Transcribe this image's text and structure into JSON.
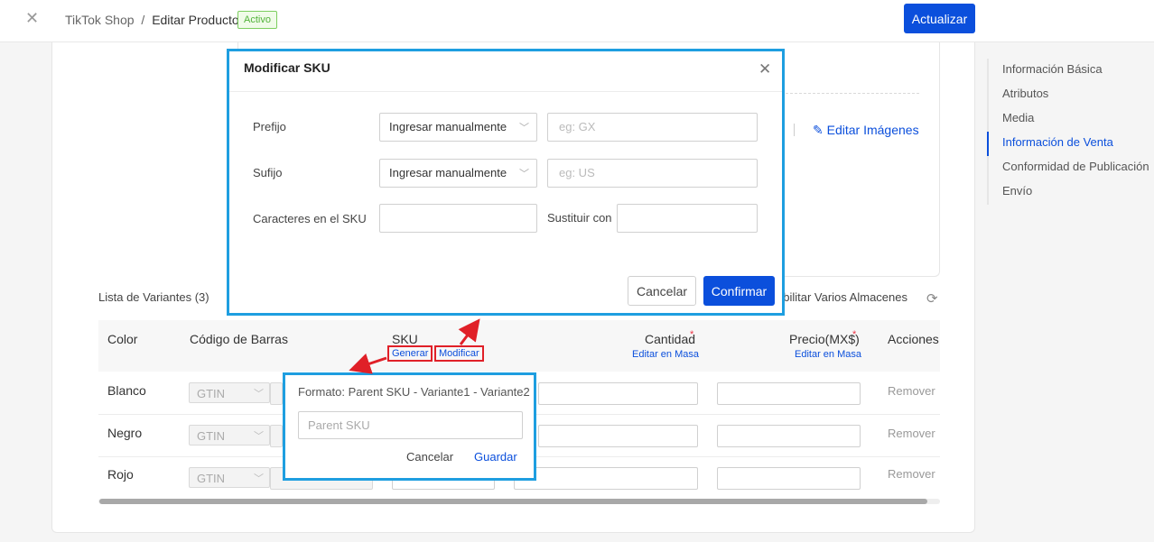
{
  "header": {
    "close_icon": "close-icon",
    "breadcrumb_root": "TikTok Shop",
    "breadcrumb_sep": "/",
    "breadcrumb_current": "Editar Producto",
    "status_badge": "Activo",
    "update_button": "Actualizar"
  },
  "media": {
    "edit_images": "Editar Imágenes"
  },
  "right_nav": {
    "items": [
      {
        "label": "Información Básica",
        "active": false
      },
      {
        "label": "Atributos",
        "active": false
      },
      {
        "label": "Media",
        "active": false
      },
      {
        "label": "Información de Venta",
        "active": true
      },
      {
        "label": "Conformidad de Publicación",
        "active": false
      },
      {
        "label": "Envío",
        "active": false
      }
    ]
  },
  "variants": {
    "title": "Lista de Variantes (3)",
    "multi_warehouse": "abilitar Varios Almacenes",
    "columns": {
      "color": "Color",
      "barcode": "Código de Barras",
      "sku": "SKU",
      "sku_generate": "Generar",
      "sku_modify": "Modificar",
      "quantity": "Cantidad",
      "quantity_bulk": "Editar en Masa",
      "price": "Precio(MX$)",
      "price_bulk": "Editar en Masa",
      "actions": "Acciones",
      "required_mark": "*"
    },
    "rows": [
      {
        "color": "Blanco",
        "barcode_type": "GTIN",
        "action": "Remover"
      },
      {
        "color": "Negro",
        "barcode_type": "GTIN",
        "action": "Remover"
      },
      {
        "color": "Rojo",
        "barcode_type": "GTIN",
        "action": "Remover"
      }
    ]
  },
  "modal": {
    "title": "Modificar SKU",
    "prefix_label": "Prefijo",
    "prefix_mode": "Ingresar manualmente",
    "prefix_placeholder": "eg: GX",
    "suffix_label": "Sufijo",
    "suffix_mode": "Ingresar manualmente",
    "suffix_placeholder": "eg: US",
    "chars_label": "Caracteres en el SKU",
    "replace_label": "Sustituir con",
    "cancel": "Cancelar",
    "confirm": "Confirmar"
  },
  "popover": {
    "format": "Formato: Parent SKU - Variante1 - Variante2",
    "placeholder": "Parent SKU",
    "cancel": "Cancelar",
    "save": "Guardar"
  },
  "colors": {
    "primary": "#0b4fdc",
    "highlight": "#1e9ee0",
    "annotation": "#e02028",
    "active_badge": "#52b33a"
  }
}
